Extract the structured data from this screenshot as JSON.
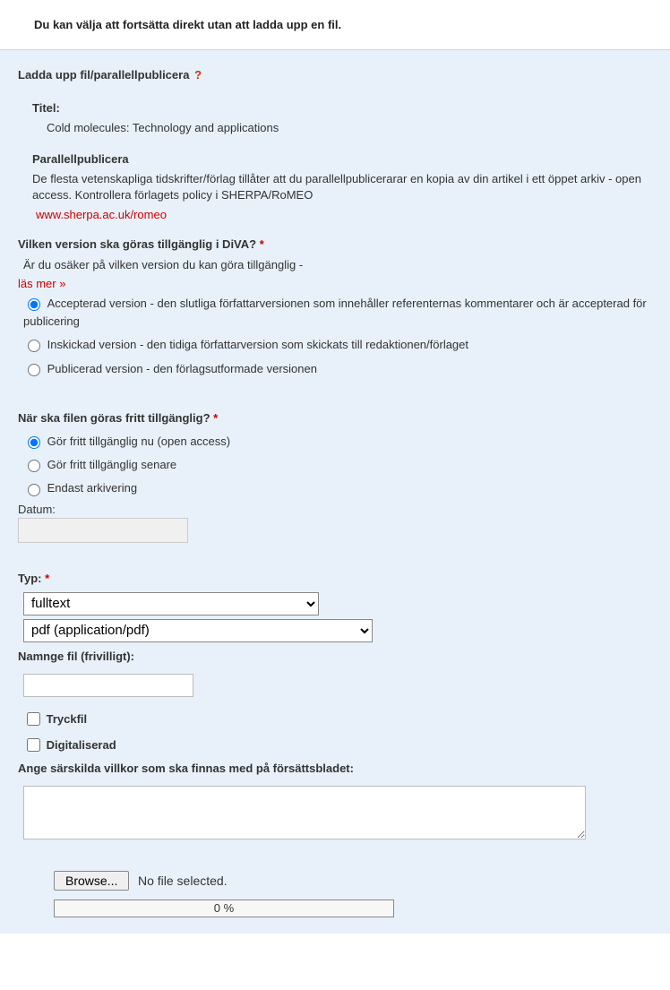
{
  "topNotice": "Du kan välja att fortsätta direkt utan att ladda upp en fil.",
  "upload": {
    "heading": "Ladda upp fil/parallellpublicera",
    "helpSymbol": "?",
    "titleLabel": "Titel:",
    "titleValue": "Cold molecules: Technology and applications",
    "parallelLabel": "Parallellpublicera",
    "parallelText": "De flesta vetenskapliga tidskrifter/förlag tillåter att du parallellpublicerarar en kopia av din artikel i ett öppet arkiv - open access. Kontrollera förlagets policy i SHERPA/RoMEO",
    "sherpaLink": "www.sherpa.ac.uk/romeo"
  },
  "version": {
    "label": "Vilken version ska göras tillgänglig i DiVA?",
    "hint": "Är du osäker på vilken version du kan göra tillgänglig -",
    "readMore": "läs mer »",
    "opt1": "Accepterad version - den slutliga författarversionen som innehåller referenternas kommentarer och är accepterad för publicering",
    "opt2": "Inskickad version - den tidiga författarversion som skickats till redaktionen/förlaget",
    "opt3": "Publicerad version - den förlagsutformade versionen"
  },
  "availability": {
    "label": "När ska filen göras fritt tillgänglig?",
    "opt1": "Gör fritt tillgänglig nu (open access)",
    "opt2": "Gör fritt tillgänglig senare",
    "opt3": "Endast arkivering",
    "dateLabel": "Datum:",
    "dateValue": ""
  },
  "type": {
    "label": "Typ:",
    "sel1": "fulltext",
    "sel2": "pdf (application/pdf)",
    "nameLabel": "Namnge fil (frivilligt):",
    "nameValue": "",
    "chk1": "Tryckfil",
    "chk2": "Digitaliserad",
    "condLabel": "Ange särskilda villkor som ska finnas med på försättsbladet:",
    "condValue": ""
  },
  "file": {
    "browse": "Browse...",
    "status": "No file selected.",
    "progress": "0 %"
  }
}
